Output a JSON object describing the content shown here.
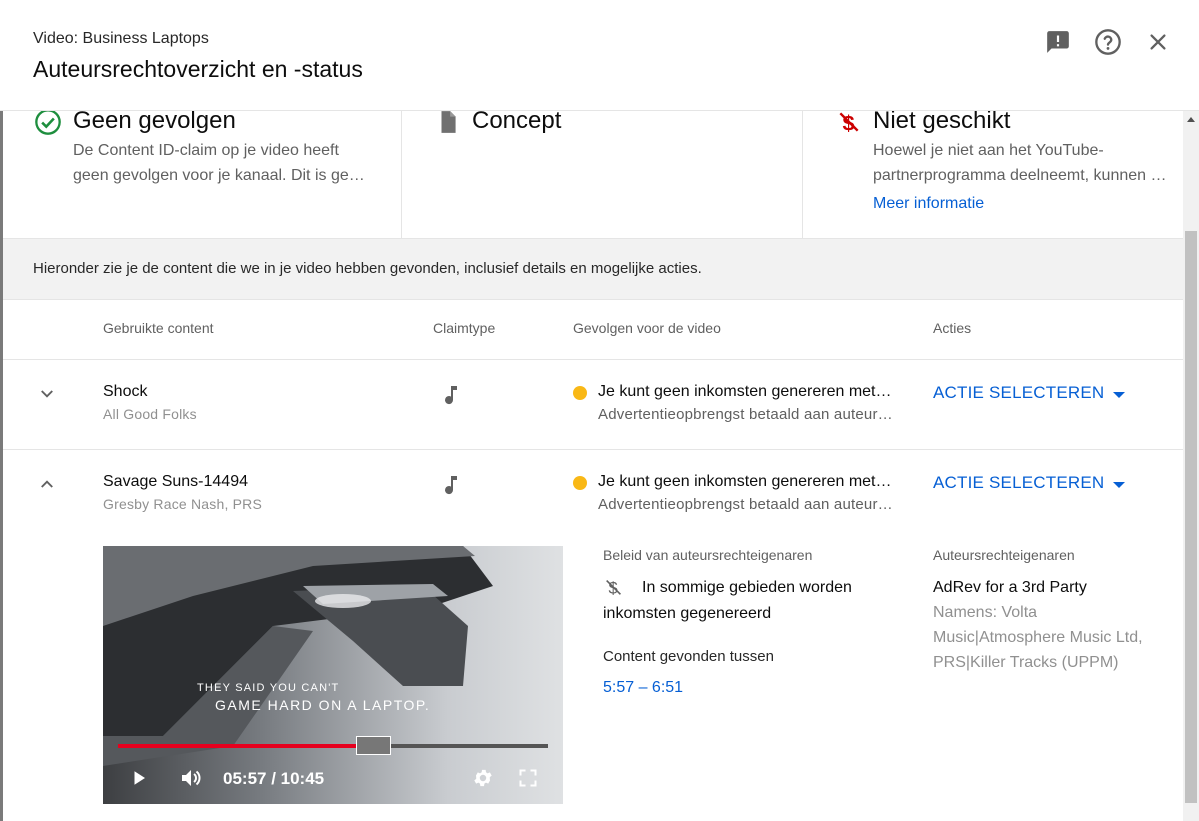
{
  "header": {
    "subtitle": "Video: Business Laptops",
    "title": "Auteursrechtoverzicht en -status",
    "icons": [
      "feedback-icon",
      "help-icon",
      "close-icon"
    ]
  },
  "status": {
    "col1": {
      "title": "Geen gevolgen",
      "desc_line1": "De Content ID-claim op je video heeft",
      "desc_line2": "geen gevolgen voor je kanaal. Dit is gee…",
      "icon": "check-circle-icon",
      "color": "#1e8e3e"
    },
    "col2": {
      "title": "Concept",
      "icon": "document-icon"
    },
    "col3": {
      "title": "Niet geschikt",
      "desc_line1": "Hoewel je niet aan het YouTube-",
      "desc_line2": "partnerprogramma deelneemt, kunnen …",
      "link": "Meer informatie",
      "icon": "no-money-icon",
      "color": "#cc0000"
    }
  },
  "info_text": "Hieronder zie je de content die we in je video hebben gevonden, inclusief details en mogelijke acties.",
  "table": {
    "headers": {
      "content": "Gebruikte content",
      "claimtype": "Claimtype",
      "impact": "Gevolgen voor de video",
      "actions": "Acties"
    },
    "rows": [
      {
        "title": "Shock",
        "artist": "All Good Folks",
        "claim_icon": "music-note-icon",
        "impact1": "Je kunt geen inkomsten genereren met deze video",
        "impact2": "Advertentieopbrengst betaald aan auteursrechteigenaar",
        "action": "ACTIE SELECTEREN",
        "expanded": false
      },
      {
        "title": "Savage Suns-14494",
        "artist": "Gresby Race Nash, PRS",
        "claim_icon": "music-note-icon",
        "impact1": "Je kunt geen inkomsten genereren met deze video",
        "impact2": "Advertentieopbrengst betaald aan auteursrechteigenaar",
        "action": "ACTIE SELECTEREN",
        "expanded": true
      }
    ]
  },
  "details": {
    "policy_label": "Beleid van auteursrechteigenaren",
    "policy_line1": "In sommige gebieden worden",
    "policy_line2": "inkomsten gegenereerd",
    "found_label": "Content gevonden tussen",
    "found_range": "5:57 – 6:51",
    "owners_label": "Auteursrechteigenaren",
    "owner_name": "AdRev for a 3rd Party",
    "owner_on_behalf1": "Namens: Volta",
    "owner_on_behalf2": "Music|Atmosphere Music Ltd,",
    "owner_on_behalf3": "PRS|Killer Tracks (UPPM)"
  },
  "video": {
    "caption_line1": "THEY SAID YOU CAN'T",
    "caption_line2": "GAME HARD ON A LAPTOP.",
    "time": "05:57 / 10:45",
    "progress": 0.557
  }
}
